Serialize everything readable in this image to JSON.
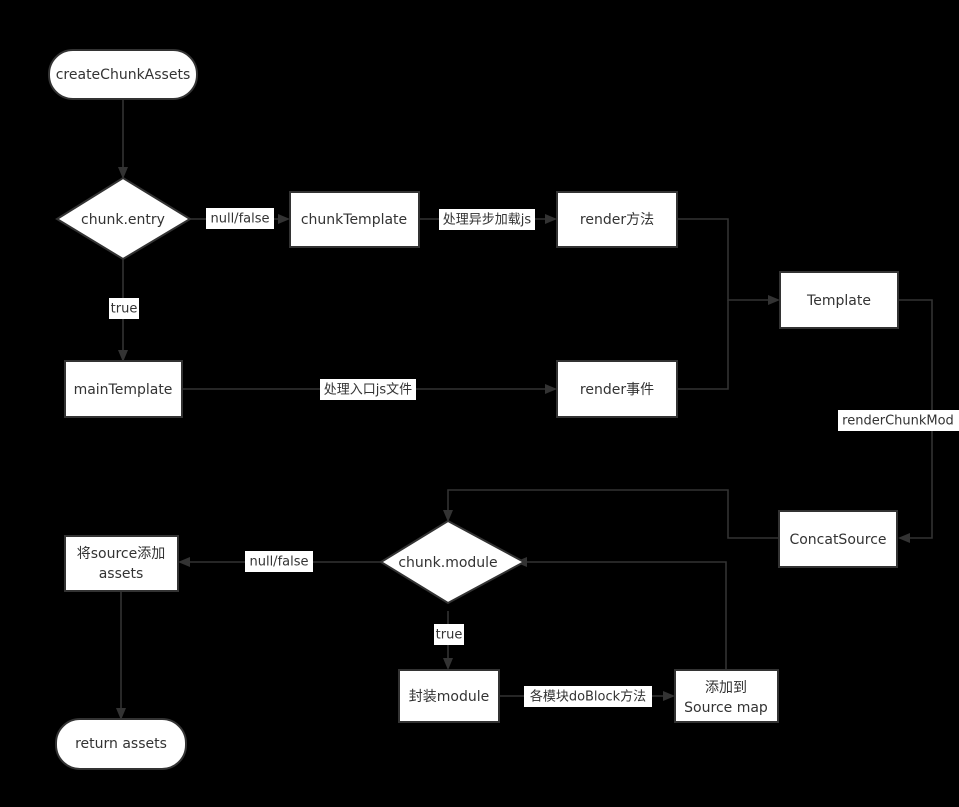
{
  "diagram": {
    "title": "createChunkAssets flowchart",
    "background_color": "#000000",
    "node_fill": "#ffffff",
    "node_stroke": "#333333",
    "edge_color": "#333333",
    "label_background": "#ffffff",
    "text_color": "#333333"
  },
  "nodes": {
    "create_chunk_assets": {
      "label": "createChunkAssets",
      "shape": "stadium"
    },
    "chunk_entry": {
      "label": "chunk.entry",
      "shape": "diamond"
    },
    "chunk_template": {
      "label": "chunkTemplate",
      "shape": "rect"
    },
    "render_method": {
      "label": "render方法",
      "shape": "rect"
    },
    "main_template": {
      "label": "mainTemplate",
      "shape": "rect"
    },
    "render_event": {
      "label": "render事件",
      "shape": "rect"
    },
    "template": {
      "label": "Template",
      "shape": "rect"
    },
    "concat_source": {
      "label": "ConcatSource",
      "shape": "rect"
    },
    "chunk_module": {
      "label": "chunk.module",
      "shape": "diamond"
    },
    "add_source_assets": {
      "label_line1": "将source添加",
      "label_line2": "assets",
      "shape": "rect"
    },
    "package_module": {
      "label": "封装module",
      "shape": "rect"
    },
    "add_to_source_map": {
      "label_line1": "添加到",
      "label_line2": "Source map",
      "shape": "rect"
    },
    "return_assets": {
      "label": "return assets",
      "shape": "stadium"
    }
  },
  "edge_labels": {
    "entry_null_false": "null/false",
    "entry_true": "true",
    "async_js": "处理异步加载js",
    "entry_js_file": "处理入口js文件",
    "render_chunk_modules": "renderChunkMod",
    "module_null_false": "null/false",
    "module_true": "true",
    "do_block": "各模块doBlock方法"
  },
  "edges": [
    {
      "from": "create_chunk_assets",
      "to": "chunk_entry",
      "label": ""
    },
    {
      "from": "chunk_entry",
      "to": "chunk_template",
      "label": "null/false"
    },
    {
      "from": "chunk_entry",
      "to": "main_template",
      "label": "true"
    },
    {
      "from": "chunk_template",
      "to": "render_method",
      "label": "处理异步加载js"
    },
    {
      "from": "main_template",
      "to": "render_event",
      "label": "处理入口js文件"
    },
    {
      "from": "render_method",
      "to": "template",
      "label": ""
    },
    {
      "from": "render_event",
      "to": "template",
      "label": ""
    },
    {
      "from": "template",
      "to": "concat_source",
      "label": "renderChunkMod"
    },
    {
      "from": "concat_source",
      "to": "chunk_module",
      "label": ""
    },
    {
      "from": "chunk_module",
      "to": "add_source_assets",
      "label": "null/false"
    },
    {
      "from": "chunk_module",
      "to": "package_module",
      "label": "true"
    },
    {
      "from": "package_module",
      "to": "add_to_source_map",
      "label": "各模块doBlock方法"
    },
    {
      "from": "add_to_source_map",
      "to": "chunk_module",
      "label": ""
    },
    {
      "from": "add_source_assets",
      "to": "return_assets",
      "label": ""
    }
  ]
}
